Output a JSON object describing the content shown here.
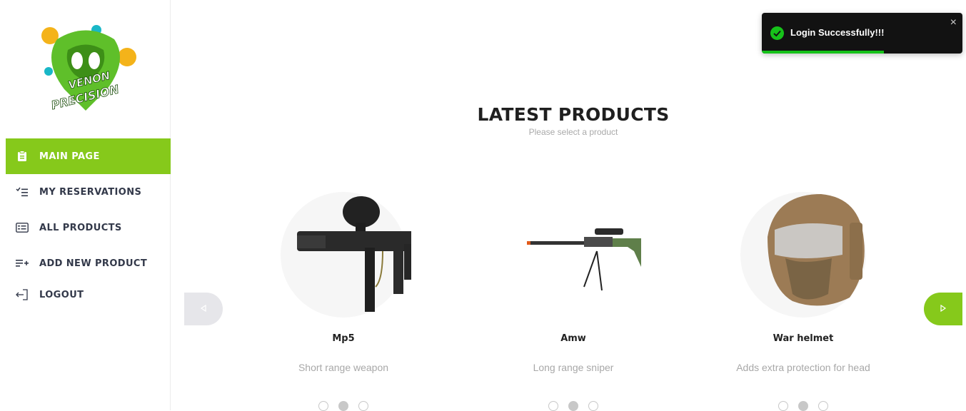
{
  "brand": {
    "logo_line1": "VENON",
    "logo_line2": "PRECISION"
  },
  "sidebar": {
    "items": [
      {
        "label": "MAIN PAGE",
        "icon": "clipboard-icon",
        "active": true
      },
      {
        "label": "MY RESERVATIONS",
        "icon": "checklist-icon",
        "active": false
      },
      {
        "label": "ALL PRODUCTS",
        "icon": "id-card-icon",
        "active": false
      },
      {
        "label": "ADD NEW PRODUCT",
        "icon": "playlist-add-icon",
        "active": false
      },
      {
        "label": "LOGOUT",
        "icon": "logout-icon",
        "active": false
      }
    ]
  },
  "toast": {
    "message": "Login Successfully!!!",
    "progress": 0.61,
    "close_symbol": "×"
  },
  "main": {
    "title": "LATEST PRODUCTS",
    "subtitle": "Please select a product"
  },
  "products": [
    {
      "name": "Mp5",
      "description": "Short range weapon",
      "image": "paintball-gun-image"
    },
    {
      "name": "Amw",
      "description": "Long range sniper",
      "image": "sniper-rifle-image"
    },
    {
      "name": "War helmet",
      "description": "Adds extra protection for head",
      "image": "tactical-helmet-image"
    }
  ],
  "colors": {
    "accent": "#86c91b",
    "success": "#16c21a",
    "toast_bg": "#121212",
    "muted": "#a8a8a8"
  }
}
